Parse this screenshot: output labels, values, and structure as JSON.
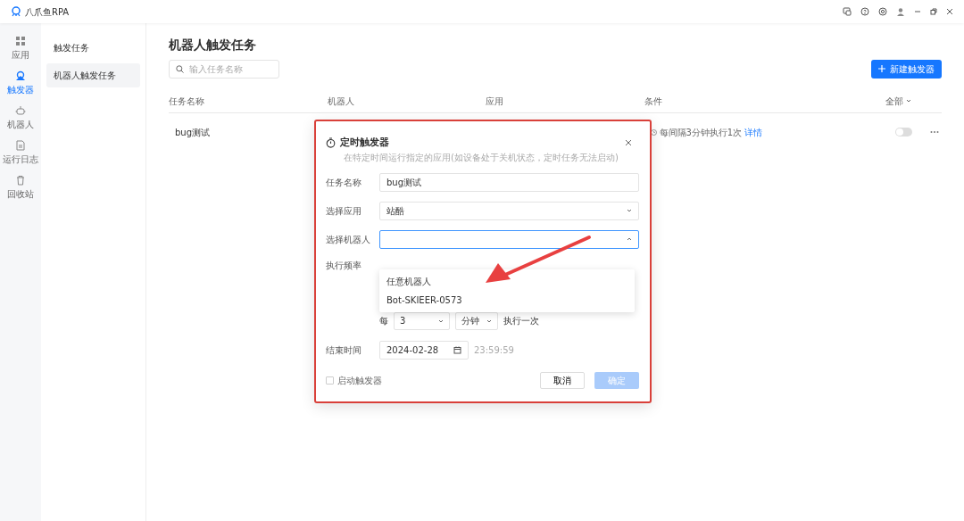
{
  "app": {
    "title": "八爪鱼RPA"
  },
  "nav": [
    {
      "label": "应用",
      "selected": false
    },
    {
      "label": "触发器",
      "selected": true
    },
    {
      "label": "机器人",
      "selected": false
    },
    {
      "label": "运行日志",
      "selected": false
    },
    {
      "label": "回收站",
      "selected": false
    }
  ],
  "subnav": [
    {
      "label": "触发任务",
      "selected": false
    },
    {
      "label": "机器人触发任务",
      "selected": true
    }
  ],
  "page": {
    "title": "机器人触发任务",
    "search": {
      "placeholder": "输入任务名称"
    },
    "new_button": "新建触发器"
  },
  "table": {
    "columns": [
      "任务名称",
      "机器人",
      "应用",
      "条件",
      "全部"
    ],
    "rows": [
      {
        "name": "bug测试",
        "condition": "每间隔3分钟执行1次",
        "detail_link": "详情",
        "on": false
      }
    ]
  },
  "dialog": {
    "title": "定时触发器",
    "subtitle": "在特定时间运行指定的应用(如设备处于关机状态，定时任务无法启动)",
    "fields": [
      {
        "kind": "text",
        "label": "任务名称",
        "value": "bug测试"
      },
      {
        "kind": "select",
        "label": "选择应用",
        "value": "站酷",
        "expanded": false
      },
      {
        "kind": "select",
        "label": "选择机器人",
        "expanded": true,
        "options": [
          "任意机器人",
          "Bot-SKIEER-0573"
        ]
      }
    ],
    "frequency": {
      "label": "执行频率",
      "prefix": "每",
      "value": "3",
      "unit": "分钟",
      "suffix": "执行一次"
    },
    "end_time": {
      "label": "结束时间",
      "date": "2024-02-28",
      "time": "23:59:59"
    },
    "enable_checkbox": {
      "label": "启动触发器",
      "checked": false
    },
    "cancel_button": "取消",
    "ok_button": {
      "label": "确定",
      "disabled": true
    }
  }
}
